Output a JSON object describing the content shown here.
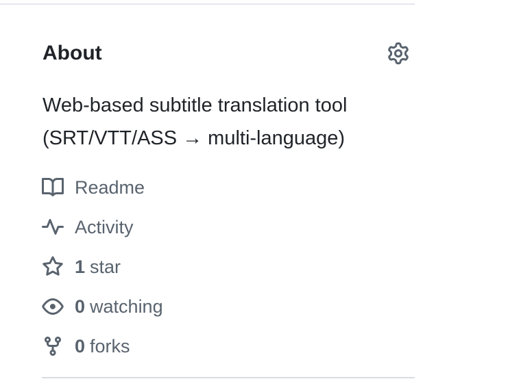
{
  "about": {
    "title": "About",
    "description_line1": "Web-based subtitle translation tool",
    "description_line2": "(SRT/VTT/ASS → multi-language)",
    "settings_icon": "gear-icon"
  },
  "stats": {
    "readme": {
      "label": "Readme",
      "icon": "book-icon"
    },
    "activity": {
      "label": "Activity",
      "icon": "pulse-icon"
    },
    "stars": {
      "count": "1",
      "label": "star",
      "icon": "star-icon"
    },
    "watching": {
      "count": "0",
      "label": "watching",
      "icon": "eye-icon"
    },
    "forks": {
      "count": "0",
      "label": "forks",
      "icon": "fork-icon"
    }
  },
  "colors": {
    "text_primary": "#1f2328",
    "text_muted": "#59636e",
    "divider": "#d8dce0"
  }
}
